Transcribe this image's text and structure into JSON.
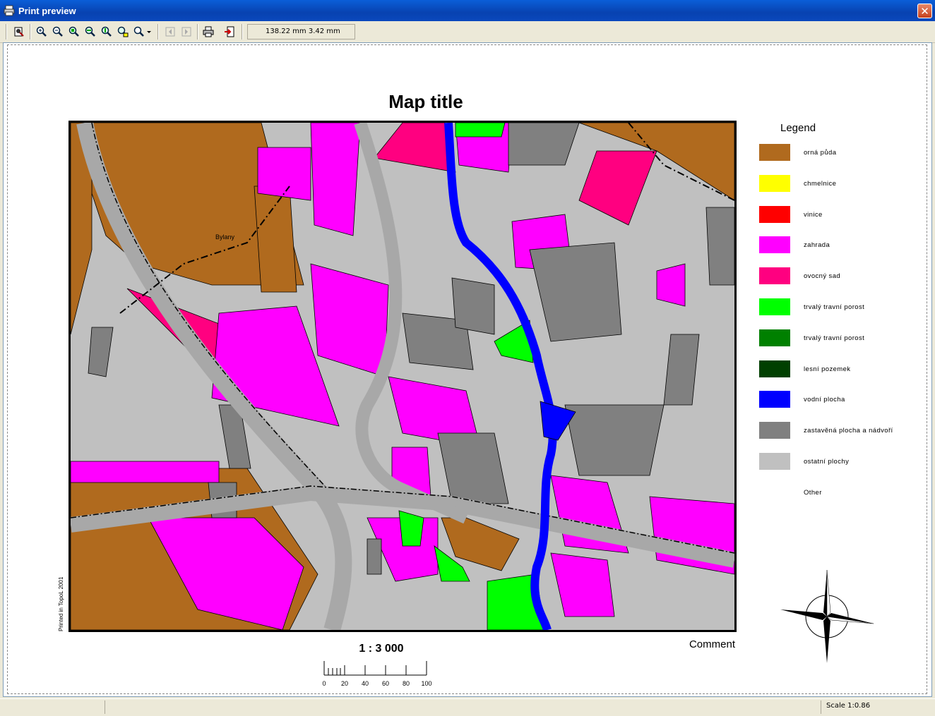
{
  "window": {
    "title": "Print preview",
    "close_glyph": "✕"
  },
  "toolbar": {
    "buttons": [
      {
        "name": "page-setup-button",
        "icon": "page-setup-icon"
      },
      {
        "name": "zoom-in-button",
        "icon": "zoom-in-icon"
      },
      {
        "name": "zoom-out-button",
        "icon": "zoom-out-icon"
      },
      {
        "name": "zoom-fit-button",
        "icon": "zoom-fit-icon"
      },
      {
        "name": "zoom-width-button",
        "icon": "zoom-width-icon"
      },
      {
        "name": "zoom-page-button",
        "icon": "zoom-page-icon"
      },
      {
        "name": "zoom-whole-button",
        "icon": "zoom-whole-icon"
      },
      {
        "name": "zoom-dropdown-button",
        "icon": "zoom-dropdown-icon"
      },
      {
        "name": "prev-page-button",
        "icon": "prev-page-icon"
      },
      {
        "name": "next-page-button",
        "icon": "next-page-icon"
      },
      {
        "name": "print-button",
        "icon": "printer-icon"
      },
      {
        "name": "exit-button",
        "icon": "exit-icon"
      }
    ],
    "coordinates": "138.22 mm   3.42 mm"
  },
  "page": {
    "map_title": "Map  title",
    "printed_in": "Printed in TopoL 2001",
    "comment": "Comment",
    "scale_label": "1 : 3 000",
    "scalebar_ticks": [
      "0",
      "20",
      "40",
      "60",
      "80",
      "100"
    ],
    "place_label": "Bylany"
  },
  "legend": {
    "title": "Legend",
    "items": [
      {
        "label": "orná půda",
        "color": "#b06a1e"
      },
      {
        "label": "chmelnice",
        "color": "#ffff00"
      },
      {
        "label": "vinice",
        "color": "#ff0000"
      },
      {
        "label": "zahrada",
        "color": "#ff00ff"
      },
      {
        "label": "ovocný sad",
        "color": "#ff0080"
      },
      {
        "label": "trvalý travní porost",
        "color": "#00ff00"
      },
      {
        "label": "trvalý travní porost",
        "color": "#008000"
      },
      {
        "label": "lesní pozemek",
        "color": "#004000"
      },
      {
        "label": "vodní plocha",
        "color": "#0000ff"
      },
      {
        "label": "zastavěná plocha a nádvoří",
        "color": "#808080"
      },
      {
        "label": "ostatní plochy",
        "color": "#c0c0c0"
      },
      {
        "label": "Other",
        "color": ""
      }
    ]
  },
  "statusbar": {
    "scale": "Scale   1:0.86"
  }
}
